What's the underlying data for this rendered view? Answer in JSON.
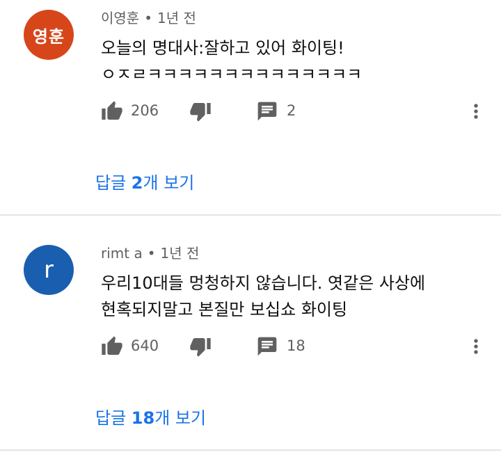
{
  "comments": [
    {
      "avatar_text": "영훈",
      "avatar_color": "#d6461a",
      "author": "이영훈",
      "time": "1년 전",
      "text_line1": "오늘의 명대사:잘하고 있어 화이팅!",
      "text_line2": "ㅇㅈㄹㅋㅋㅋㅋㅋㅋㅋㅋㅋㅋㅋㅋㅋㅋ",
      "likes": "206",
      "replies_count": "2",
      "view_replies": {
        "prefix": "답글 ",
        "count": "2",
        "suffix": "개 보기"
      }
    },
    {
      "avatar_text": "r",
      "avatar_color": "#1a5faf",
      "author": "rimt a",
      "time": "1년 전",
      "text_line1": "우리10대들 멍청하지 않습니다. 엿같은 사상에",
      "text_line2": "현혹되지말고 본질만 보십쇼 화이팅",
      "likes": "640",
      "replies_count": "18",
      "view_replies": {
        "prefix": "답글 ",
        "count": "18",
        "suffix": "개 보기"
      }
    }
  ],
  "meta_separator": "•",
  "icons": {
    "like": "thumbs-up-icon",
    "dislike": "thumbs-down-icon",
    "reply": "comment-icon",
    "more": "more-vertical-icon"
  },
  "colors": {
    "link": "#1a73e8",
    "secondary_text": "#606060",
    "icon": "#606060"
  }
}
